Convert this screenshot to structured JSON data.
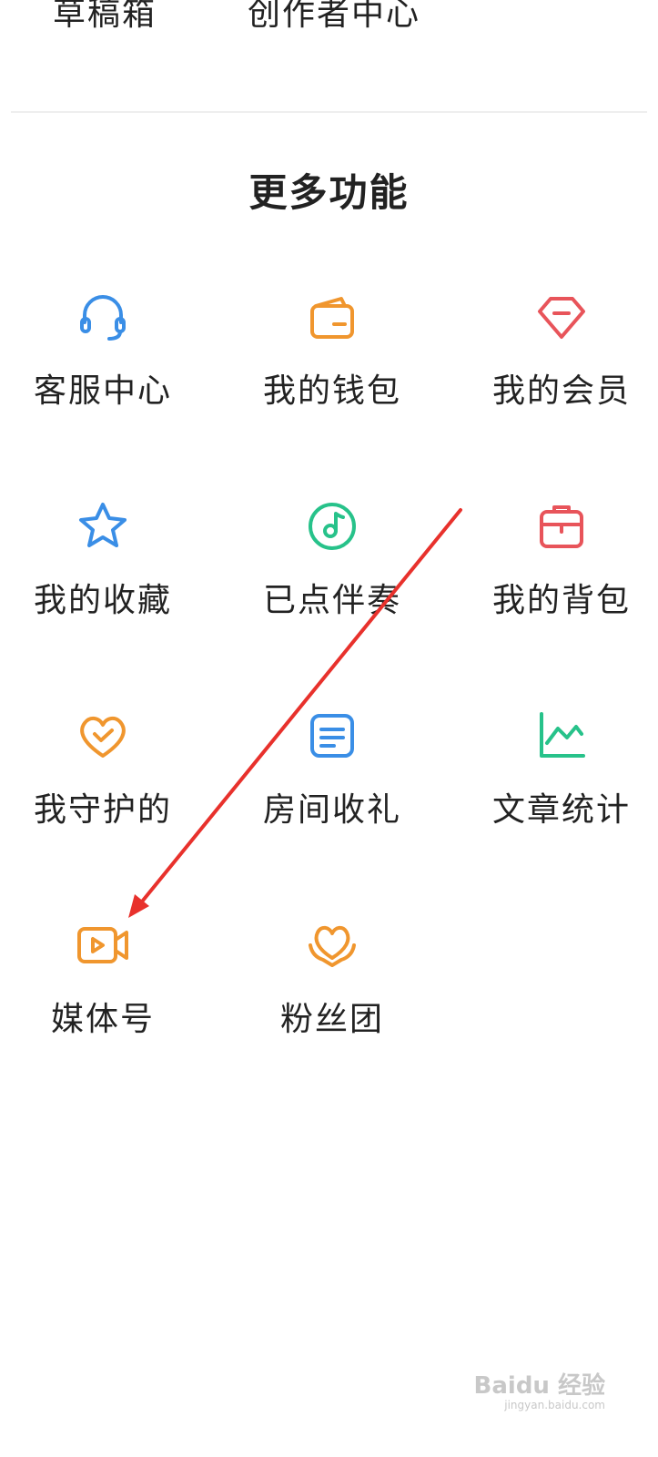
{
  "top_links": [
    "草稿箱",
    "创作者中心"
  ],
  "section_title": "更多功能",
  "items": [
    {
      "label": "客服中心",
      "icon": "headset-icon",
      "color": "#3a8ee6"
    },
    {
      "label": "我的钱包",
      "icon": "wallet-icon",
      "color": "#f0962e"
    },
    {
      "label": "我的会员",
      "icon": "diamond-icon",
      "color": "#e8545a"
    },
    {
      "label": "我的收藏",
      "icon": "star-icon",
      "color": "#3a8ee6"
    },
    {
      "label": "已点伴奏",
      "icon": "music-icon",
      "color": "#27c28a"
    },
    {
      "label": "我的背包",
      "icon": "backpack-icon",
      "color": "#e8545a"
    },
    {
      "label": "我守护的",
      "icon": "heart-check-icon",
      "color": "#f0962e"
    },
    {
      "label": "房间收礼",
      "icon": "document-icon",
      "color": "#3a8ee6"
    },
    {
      "label": "文章统计",
      "icon": "line-chart-icon",
      "color": "#27c28a"
    },
    {
      "label": "媒体号",
      "icon": "video-icon",
      "color": "#f0962e"
    },
    {
      "label": "粉丝团",
      "icon": "heart-hands-icon",
      "color": "#f0962e"
    }
  ],
  "watermark": {
    "text": "Baidu 经验",
    "sub": "jingyan.baidu.com"
  },
  "annotation_color": "#e8312c"
}
